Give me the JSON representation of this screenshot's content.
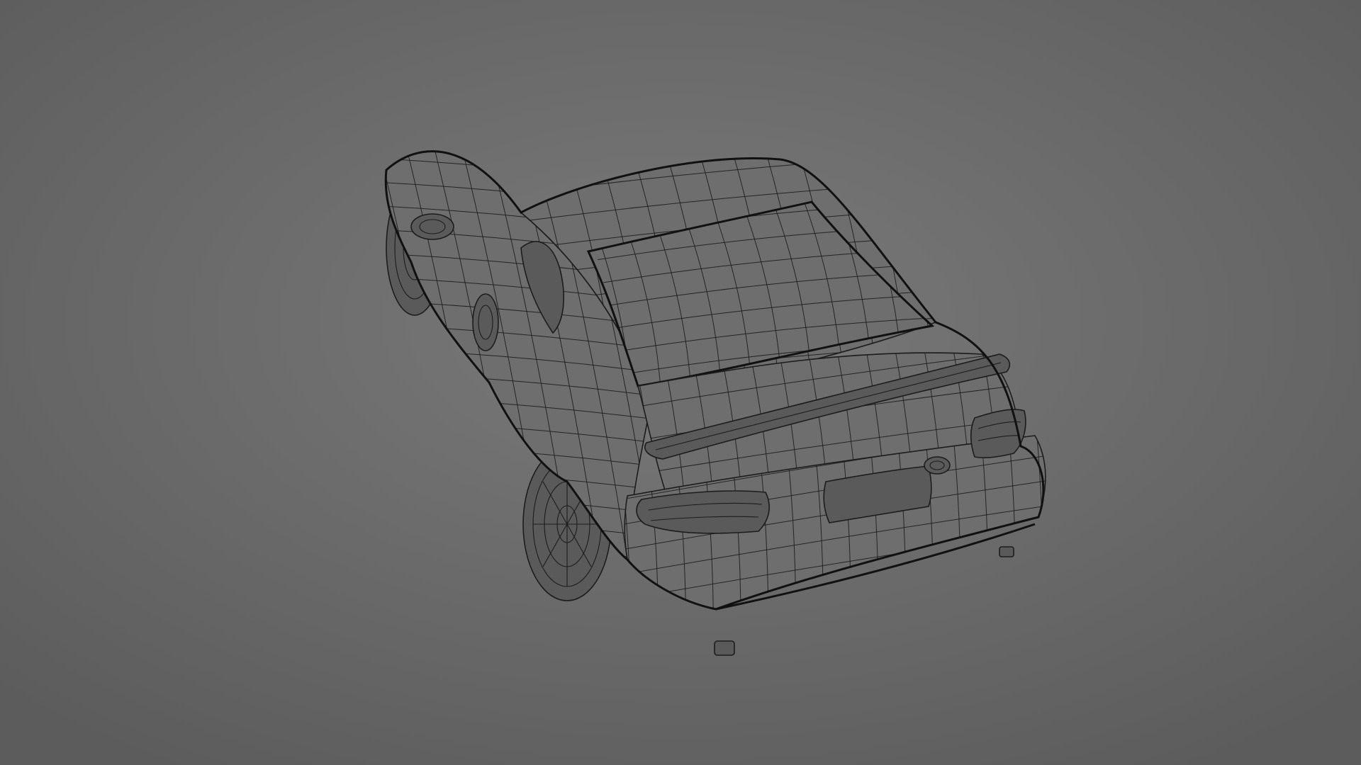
{
  "scene": {
    "subject": "car",
    "render_style": "wireframe",
    "background_center": "#7a7a7a",
    "background_edge": "#5c5c5c",
    "surface_fill": "#6e6e6e",
    "surface_fill_dark": "#5a5a5a",
    "wire_color": "#1c1c1c",
    "edge_color": "#111111"
  }
}
